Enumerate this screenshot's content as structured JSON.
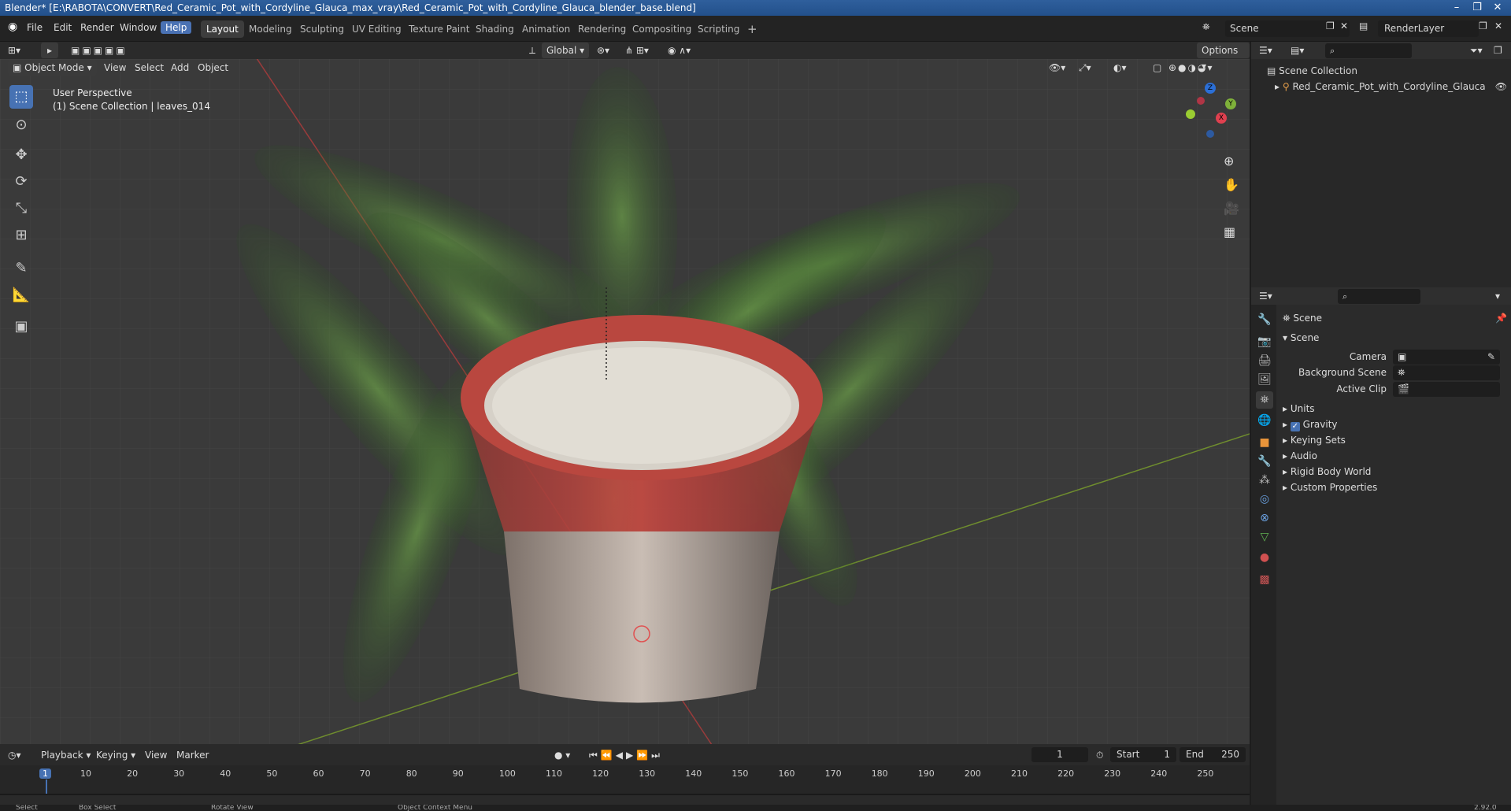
{
  "title": "Blender* [E:\\RABOTA\\CONVERT\\Red_Ceramic_Pot_with_Cordyline_Glauca_max_vray\\Red_Ceramic_Pot_with_Cordyline_Glauca_blender_base.blend]",
  "menu": [
    "File",
    "Edit",
    "Render",
    "Window",
    "Help"
  ],
  "workspaces": [
    "Layout",
    "Modeling",
    "Sculpting",
    "UV Editing",
    "Texture Paint",
    "Shading",
    "Animation",
    "Rendering",
    "Compositing",
    "Scripting"
  ],
  "scene_name": "Scene",
  "render_layer": "RenderLayer",
  "header": {
    "mode": "Object Mode",
    "view": "View",
    "select": "Select",
    "add": "Add",
    "object": "Object",
    "transform": "Global",
    "options": "Options"
  },
  "viewport": {
    "perspective": "User Perspective",
    "collection": "(1) Scene Collection | leaves_014"
  },
  "gizmo": {
    "x": "X",
    "y": "Y",
    "z": "Z"
  },
  "outliner": {
    "root": "Scene Collection",
    "item": "Red_Ceramic_Pot_with_Cordyline_Glauca"
  },
  "properties": {
    "context": "Scene",
    "panel": "Scene",
    "camera_label": "Camera",
    "bg_label": "Background Scene",
    "clip_label": "Active Clip",
    "sections": [
      "Units",
      "Gravity",
      "Keying Sets",
      "Audio",
      "Rigid Body World",
      "Custom Properties"
    ]
  },
  "timeline": {
    "playback": "Playback",
    "keying": "Keying",
    "view": "View",
    "marker": "Marker",
    "current": "1",
    "start_label": "Start",
    "start": "1",
    "end_label": "End",
    "end": "250",
    "ticks": [
      "1",
      "10",
      "20",
      "30",
      "40",
      "50",
      "60",
      "70",
      "80",
      "90",
      "100",
      "110",
      "120",
      "130",
      "140",
      "150",
      "160",
      "170",
      "180",
      "190",
      "200",
      "210",
      "220",
      "230",
      "240",
      "250"
    ]
  },
  "status": {
    "select": "Select",
    "box": "Box Select",
    "rotate": "Rotate View",
    "context": "Object Context Menu",
    "version": "2.92.0"
  }
}
